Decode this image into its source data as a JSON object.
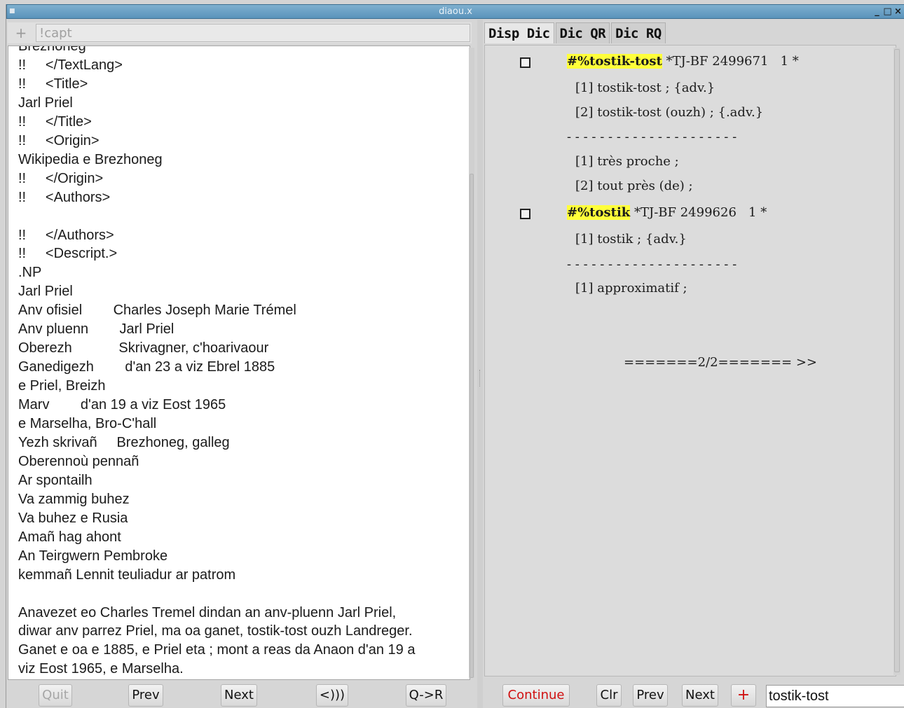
{
  "window": {
    "title": "diaou.x",
    "controls": [
      "_",
      "□",
      "×"
    ]
  },
  "left": {
    "search": {
      "add_label": "+",
      "value": "!capt"
    },
    "text_lines": [
      "Brezhoneg",
      "!!     </TextLang>",
      "!!     <Title>",
      "Jarl Priel",
      "!!     </Title>",
      "!!     <Origin>",
      "Wikipedia e Brezhoneg",
      "!!     </Origin>",
      "!!     <Authors>",
      "",
      "!!     </Authors>",
      "!!     <Descript.>",
      ".NP",
      "Jarl Priel",
      "Anv ofisiel        Charles Joseph Marie Trémel",
      "Anv pluenn        Jarl Priel",
      "Oberezh            Skrivagner, c'hoarivaour",
      "Ganedigezh        d'an 23 a viz Ebrel 1885",
      "e Priel, Breizh",
      "Marv        d'an 19 a viz Eost 1965",
      "e Marselha, Bro-C'hall",
      "Yezh skrivañ     Brezhoneg, galleg",
      "Oberennoù pennañ",
      "Ar spontailh",
      "Va zammig buhez",
      "Va buhez e Rusia",
      "Amañ hag ahont",
      "An Teirgwern Pembroke",
      "kemmañ Lennit teuliadur ar patrom",
      "",
      "Anavezet eo Charles Tremel dindan an anv-pluenn Jarl Priel,",
      "diwar anv parrez Priel, ma oa ganet, tostik-tost ouzh Landreger.",
      "Ganet e oa e 1885, e Priel eta ; mont a reas da Anaon d'an 19 a",
      "viz Eost 1965, e Marselha."
    ],
    "buttons": {
      "quit": "Quit",
      "prev": "Prev",
      "next": "Next",
      "speak": "<)))",
      "qr": "Q->R"
    }
  },
  "right": {
    "tabs": [
      "Disp Dic",
      "Dic QR",
      "Dic RQ"
    ],
    "entries": [
      {
        "headword": "#%tostik-tost",
        "meta": " *TJ-BF 2499671   1 *",
        "senses": [
          "[1] tostik-tost ; {adv.}",
          "[2] tostik-tost (ouzh) ; {.adv.}"
        ],
        "separator": "- - - - - - - - - - - - - - - - - - - - -",
        "translations": [
          "[1] très proche ;",
          "[2] tout près (de) ;"
        ]
      },
      {
        "headword": "#%tostik",
        "meta": " *TJ-BF 2499626   1 *",
        "senses": [
          "[1] tostik ; {adv.}"
        ],
        "separator": "- - - - - - - - - - - - - - - - - - - - -",
        "translations": [
          "[1] approximatif ;"
        ]
      }
    ],
    "pager": "=======2/2======= >>",
    "buttons": {
      "continue": "Continue",
      "clr": "Clr",
      "prev": "Prev",
      "next": "Next",
      "add": "+"
    },
    "word_input": "tostik-tost",
    "colors": {
      "highlight": "#ffff3a",
      "continue_text": "#d01010",
      "add_text": "#d01010"
    }
  }
}
